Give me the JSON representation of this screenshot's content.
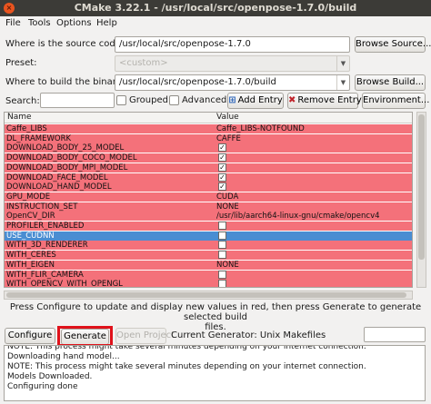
{
  "window": {
    "title": "CMake 3.22.1 - /usr/local/src/openpose-1.7.0/build",
    "close_glyph": "×"
  },
  "menu": [
    "File",
    "Tools",
    "Options",
    "Help"
  ],
  "source": {
    "label": "Where is the source code:",
    "value": "/usr/local/src/openpose-1.7.0",
    "browse": "Browse Source..."
  },
  "preset": {
    "label": "Preset:",
    "value": "<custom>"
  },
  "binaries": {
    "label": "Where to build the binaries:",
    "value": "/usr/local/src/openpose-1.7.0/build",
    "browse": "Browse Build..."
  },
  "search": {
    "label": "Search:",
    "value": "",
    "grouped_label": "Grouped",
    "advanced_label": "Advanced",
    "add_entry": "Add Entry",
    "remove_entry": "Remove Entry",
    "environment": "Environment..."
  },
  "table": {
    "headers": {
      "name": "Name",
      "value": "Value"
    },
    "rows": [
      {
        "name": "Caffe_LIBS",
        "value": "Caffe_LIBS-NOTFOUND"
      },
      {
        "name": "DL_FRAMEWORK",
        "value": "CAFFE"
      },
      {
        "name": "DOWNLOAD_BODY_25_MODEL",
        "value": "✓"
      },
      {
        "name": "DOWNLOAD_BODY_COCO_MODEL",
        "value": "✓"
      },
      {
        "name": "DOWNLOAD_BODY_MPI_MODEL",
        "value": "✓"
      },
      {
        "name": "DOWNLOAD_FACE_MODEL",
        "value": "✓"
      },
      {
        "name": "DOWNLOAD_HAND_MODEL",
        "value": "✓"
      },
      {
        "name": "GPU_MODE",
        "value": "CUDA"
      },
      {
        "name": "INSTRUCTION_SET",
        "value": "NONE"
      },
      {
        "name": "OpenCV_DIR",
        "value": "/usr/lib/aarch64-linux-gnu/cmake/opencv4"
      },
      {
        "name": "PROFILER_ENABLED",
        "value": ""
      },
      {
        "name": "USE_CUDNN",
        "value": ""
      },
      {
        "name": "WITH_3D_RENDERER",
        "value": ""
      },
      {
        "name": "WITH_CERES",
        "value": ""
      },
      {
        "name": "WITH_EIGEN",
        "value": "NONE"
      },
      {
        "name": "WITH_FLIR_CAMERA",
        "value": ""
      },
      {
        "name": "WITH_OPENCV_WITH_OPENGL",
        "value": ""
      }
    ]
  },
  "info_lines": [
    "Press Configure to update and display new values in red, then press Generate to generate selected build",
    "files."
  ],
  "actions": {
    "configure": "Configure",
    "generate": "Generate",
    "open_project": "Open Project",
    "current_generator": "Current Generator: Unix Makefiles"
  },
  "output_lines": [
    "NOTE: This process might take several minutes depending on your internet connection.",
    "Downloading hand model...",
    "NOTE: This process might take several minutes depending on your internet connection.",
    "Models Downloaded.",
    "Configuring done"
  ],
  "colors": {
    "changed_row": "#f4717a",
    "selected_row": "#4a8dd2",
    "highlight_box": "#e0121b",
    "titlebar": "#3c3b37"
  }
}
